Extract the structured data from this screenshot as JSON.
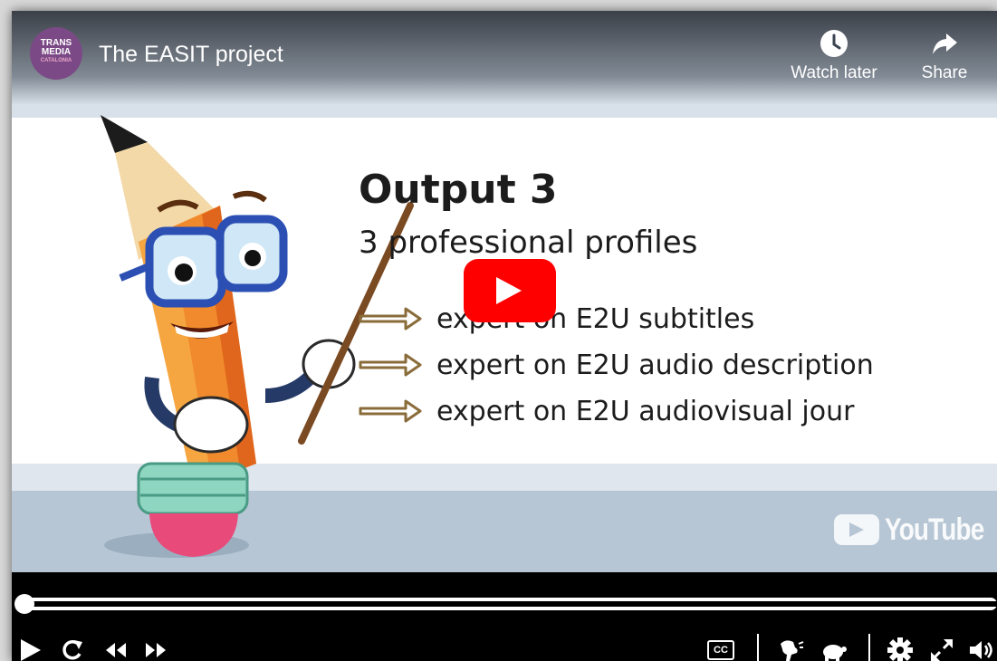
{
  "video": {
    "title": "The EASIT project",
    "channel_logo": {
      "line1": "TRANS",
      "line2": "MEDIA",
      "line3": "CATALONIA"
    },
    "actions": [
      {
        "label": "Watch later",
        "icon": "clock-icon"
      },
      {
        "label": "Share",
        "icon": "share-arrow-icon"
      }
    ],
    "watermark": "YouTube"
  },
  "slide": {
    "heading": "Output 3",
    "subheading": "3 professional profiles",
    "bullets": [
      "expert on E2U subtitles",
      "expert on E2U audio description",
      "expert on E2U audiovisual jour"
    ]
  },
  "controls": {
    "progress": 0,
    "left": [
      "play-icon",
      "replay-icon",
      "rewind-icon",
      "fast-forward-icon"
    ],
    "right": [
      "closed-captions-icon",
      "speed-fast-icon",
      "speed-slow-icon",
      "settings-gear-icon",
      "fullscreen-icon",
      "volume-icon"
    ],
    "cc_label": "CC"
  },
  "colors": {
    "play_button": "#ff0000",
    "logo_bg": "#7b4a86"
  }
}
